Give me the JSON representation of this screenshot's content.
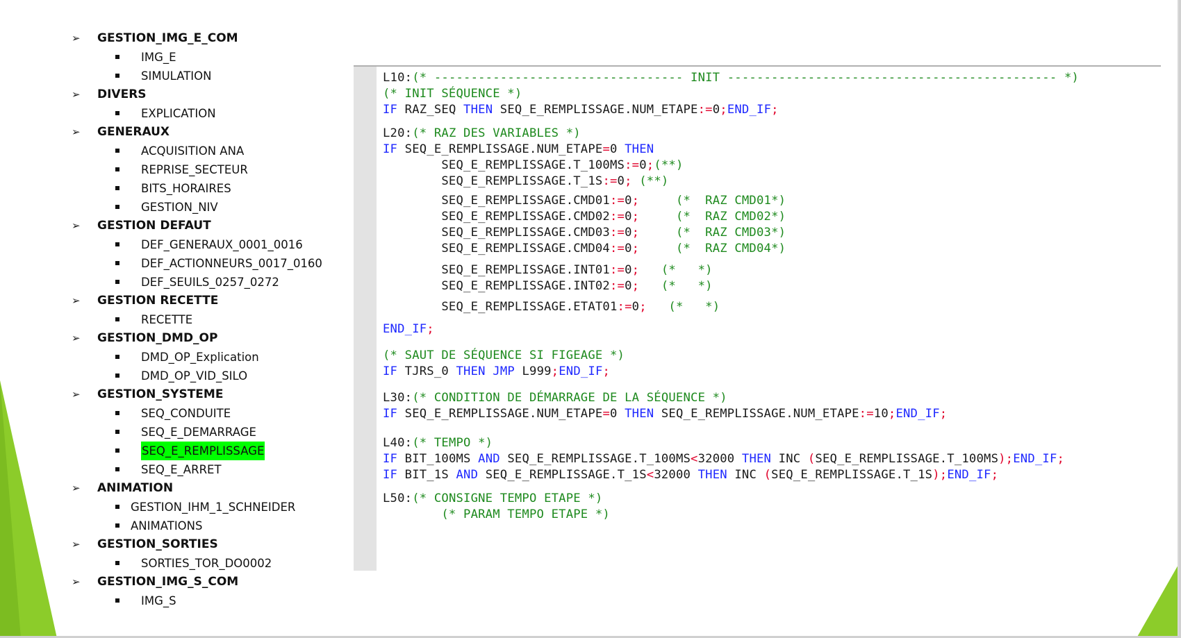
{
  "outline": {
    "groups": [
      {
        "label": "GESTION_IMG_E_COM",
        "items": [
          {
            "label": "IMG_E"
          },
          {
            "label": "SIMULATION"
          }
        ]
      },
      {
        "label": "DIVERS",
        "items": [
          {
            "label": "EXPLICATION"
          }
        ]
      },
      {
        "label": "GENERAUX",
        "items": [
          {
            "label": "ACQUISITION ANA"
          },
          {
            "label": "REPRISE_SECTEUR"
          },
          {
            "label": "BITS_HORAIRES"
          },
          {
            "label": "GESTION_NIV"
          }
        ]
      },
      {
        "label": "GESTION DEFAUT",
        "items": [
          {
            "label": "DEF_GENERAUX_0001_0016"
          },
          {
            "label": "DEF_ACTIONNEURS_0017_0160"
          },
          {
            "label": "DEF_SEUILS_0257_0272"
          }
        ]
      },
      {
        "label": "GESTION RECETTE",
        "items": [
          {
            "label": "RECETTE"
          }
        ]
      },
      {
        "label": "GESTION_DMD_OP",
        "items": [
          {
            "label": "DMD_OP_Explication"
          },
          {
            "label": "DMD_OP_VID_SILO"
          }
        ]
      },
      {
        "label": "GESTION_SYSTEME",
        "items": [
          {
            "label": "SEQ_CONDUITE"
          },
          {
            "label": "SEQ_E_DEMARRAGE"
          },
          {
            "label": "SEQ_E_REMPLISSAGE",
            "highlighted": true
          },
          {
            "label": "SEQ_E_ARRET"
          }
        ]
      },
      {
        "label": "ANIMATION",
        "items": [
          {
            "label": "GESTION_IHM_1_SCHNEIDER",
            "alt": true
          },
          {
            "label": "ANIMATIONS",
            "alt": true
          }
        ]
      },
      {
        "label": "GESTION_SORTIES",
        "items": [
          {
            "label": "SORTIES_TOR_DO0002"
          }
        ]
      },
      {
        "label": "GESTION_IMG_S_COM",
        "items": [
          {
            "label": "IMG_S"
          }
        ]
      }
    ]
  },
  "code": {
    "lines": [
      [
        [
          "lbl",
          "L10:"
        ],
        [
          "cm",
          "(* ---------------------------------- INIT --------------------------------------------- *)"
        ]
      ],
      [
        [
          "cm",
          "(* INIT SÉQUENCE *)"
        ]
      ],
      [
        [
          "kw",
          "IF"
        ],
        [
          "def",
          " RAZ_SEQ "
        ],
        [
          "kw",
          "THEN"
        ],
        [
          "def",
          " SEQ_E_REMPLISSAGE.NUM_ETAPE"
        ],
        [
          "op",
          ":="
        ],
        [
          "def",
          "0"
        ],
        [
          "op",
          ";"
        ],
        [
          "kw",
          "END_IF"
        ],
        [
          "op",
          ";"
        ]
      ],
      [
        [
          "lbl",
          "L20:"
        ],
        [
          "cm",
          "(* RAZ DES VARIABLES *)"
        ]
      ],
      [
        [
          "kw",
          "IF"
        ],
        [
          "def",
          " SEQ_E_REMPLISSAGE.NUM_ETAPE"
        ],
        [
          "op",
          "="
        ],
        [
          "def",
          "0 "
        ],
        [
          "kw",
          "THEN"
        ]
      ],
      [
        [
          "def",
          "        SEQ_E_REMPLISSAGE.T_100MS"
        ],
        [
          "op",
          ":="
        ],
        [
          "def",
          "0"
        ],
        [
          "op",
          ";"
        ],
        [
          "cm",
          "(**)"
        ]
      ],
      [
        [
          "def",
          "        SEQ_E_REMPLISSAGE.T_1S"
        ],
        [
          "op",
          ":="
        ],
        [
          "def",
          "0"
        ],
        [
          "op",
          ";"
        ],
        [
          "cm",
          " (**)"
        ]
      ],
      [
        [
          "def",
          "        SEQ_E_REMPLISSAGE.CMD01"
        ],
        [
          "op",
          ":="
        ],
        [
          "def",
          "0"
        ],
        [
          "op",
          ";"
        ],
        [
          "cm",
          "     (*  RAZ CMD01*)"
        ]
      ],
      [
        [
          "def",
          "        SEQ_E_REMPLISSAGE.CMD02"
        ],
        [
          "op",
          ":="
        ],
        [
          "def",
          "0"
        ],
        [
          "op",
          ";"
        ],
        [
          "cm",
          "     (*  RAZ CMD02*)"
        ]
      ],
      [
        [
          "def",
          "        SEQ_E_REMPLISSAGE.CMD03"
        ],
        [
          "op",
          ":="
        ],
        [
          "def",
          "0"
        ],
        [
          "op",
          ";"
        ],
        [
          "cm",
          "     (*  RAZ CMD03*)"
        ]
      ],
      [
        [
          "def",
          "        SEQ_E_REMPLISSAGE.CMD04"
        ],
        [
          "op",
          ":="
        ],
        [
          "def",
          "0"
        ],
        [
          "op",
          ";"
        ],
        [
          "cm",
          "     (*  RAZ CMD04*)"
        ]
      ],
      [
        [
          "def",
          "        SEQ_E_REMPLISSAGE.INT01"
        ],
        [
          "op",
          ":="
        ],
        [
          "def",
          "0"
        ],
        [
          "op",
          ";"
        ],
        [
          "cm",
          "   (*   *)"
        ]
      ],
      [
        [
          "def",
          "        SEQ_E_REMPLISSAGE.INT02"
        ],
        [
          "op",
          ":="
        ],
        [
          "def",
          "0"
        ],
        [
          "op",
          ";"
        ],
        [
          "cm",
          "   (*   *)"
        ]
      ],
      [
        [
          "def",
          "        SEQ_E_REMPLISSAGE.ETAT01"
        ],
        [
          "op",
          ":="
        ],
        [
          "def",
          "0"
        ],
        [
          "op",
          ";"
        ],
        [
          "cm",
          "   (*   *)"
        ]
      ],
      [
        [
          "kw",
          "END_IF"
        ],
        [
          "op",
          ";"
        ]
      ],
      [
        [
          "cm",
          "(* SAUT DE SÉQUENCE SI FIGEAGE *)"
        ]
      ],
      [
        [
          "kw",
          "IF"
        ],
        [
          "def",
          " TJRS_0 "
        ],
        [
          "kw",
          "THEN"
        ],
        [
          "def",
          " "
        ],
        [
          "kw",
          "JMP"
        ],
        [
          "def",
          " L999"
        ],
        [
          "op",
          ";"
        ],
        [
          "kw",
          "END_IF"
        ],
        [
          "op",
          ";"
        ]
      ],
      [
        [
          "lbl",
          "L30:"
        ],
        [
          "cm",
          "(* CONDITION DE DÉMARRAGE DE LA SÉQUENCE *)"
        ]
      ],
      [
        [
          "kw",
          "IF"
        ],
        [
          "def",
          " SEQ_E_REMPLISSAGE.NUM_ETAPE"
        ],
        [
          "op",
          "="
        ],
        [
          "def",
          "0 "
        ],
        [
          "kw",
          "THEN"
        ],
        [
          "def",
          " SEQ_E_REMPLISSAGE.NUM_ETAPE"
        ],
        [
          "op",
          ":="
        ],
        [
          "def",
          "10"
        ],
        [
          "op",
          ";"
        ],
        [
          "kw",
          "END_IF"
        ],
        [
          "op",
          ";"
        ]
      ],
      [
        [
          "lbl",
          "L40:"
        ],
        [
          "cm",
          "(* TEMPO *)"
        ]
      ],
      [
        [
          "kw",
          "IF"
        ],
        [
          "def",
          " BIT_100MS "
        ],
        [
          "kw",
          "AND"
        ],
        [
          "def",
          " SEQ_E_REMPLISSAGE.T_100MS"
        ],
        [
          "op",
          "<"
        ],
        [
          "def",
          "32000 "
        ],
        [
          "kw",
          "THEN"
        ],
        [
          "def",
          " INC "
        ],
        [
          "op",
          "("
        ],
        [
          "def",
          "SEQ_E_REMPLISSAGE.T_100MS"
        ],
        [
          "op",
          ");"
        ],
        [
          "kw",
          "END_IF"
        ],
        [
          "op",
          ";"
        ]
      ],
      [
        [
          "kw",
          "IF"
        ],
        [
          "def",
          " BIT_1S "
        ],
        [
          "kw",
          "AND"
        ],
        [
          "def",
          " SEQ_E_REMPLISSAGE.T_1S"
        ],
        [
          "op",
          "<"
        ],
        [
          "def",
          "32000 "
        ],
        [
          "kw",
          "THEN"
        ],
        [
          "def",
          " INC "
        ],
        [
          "op",
          "("
        ],
        [
          "def",
          "SEQ_E_REMPLISSAGE.T_1S"
        ],
        [
          "op",
          ");"
        ],
        [
          "kw",
          "END_IF"
        ],
        [
          "op",
          ";"
        ]
      ],
      [
        [
          "lbl",
          "L50:"
        ],
        [
          "cm",
          "(* CONSIGNE TEMPO ETAPE *)"
        ]
      ],
      [
        [
          "cm",
          "        (* PARAM TEMPO ETAPE *)"
        ]
      ]
    ]
  },
  "colors": {
    "accent_green": "#8ccc2a",
    "highlight": "#00ff00",
    "keyword": "#1e28ff",
    "comment": "#1e8a1e",
    "operator": "#e0002a"
  }
}
